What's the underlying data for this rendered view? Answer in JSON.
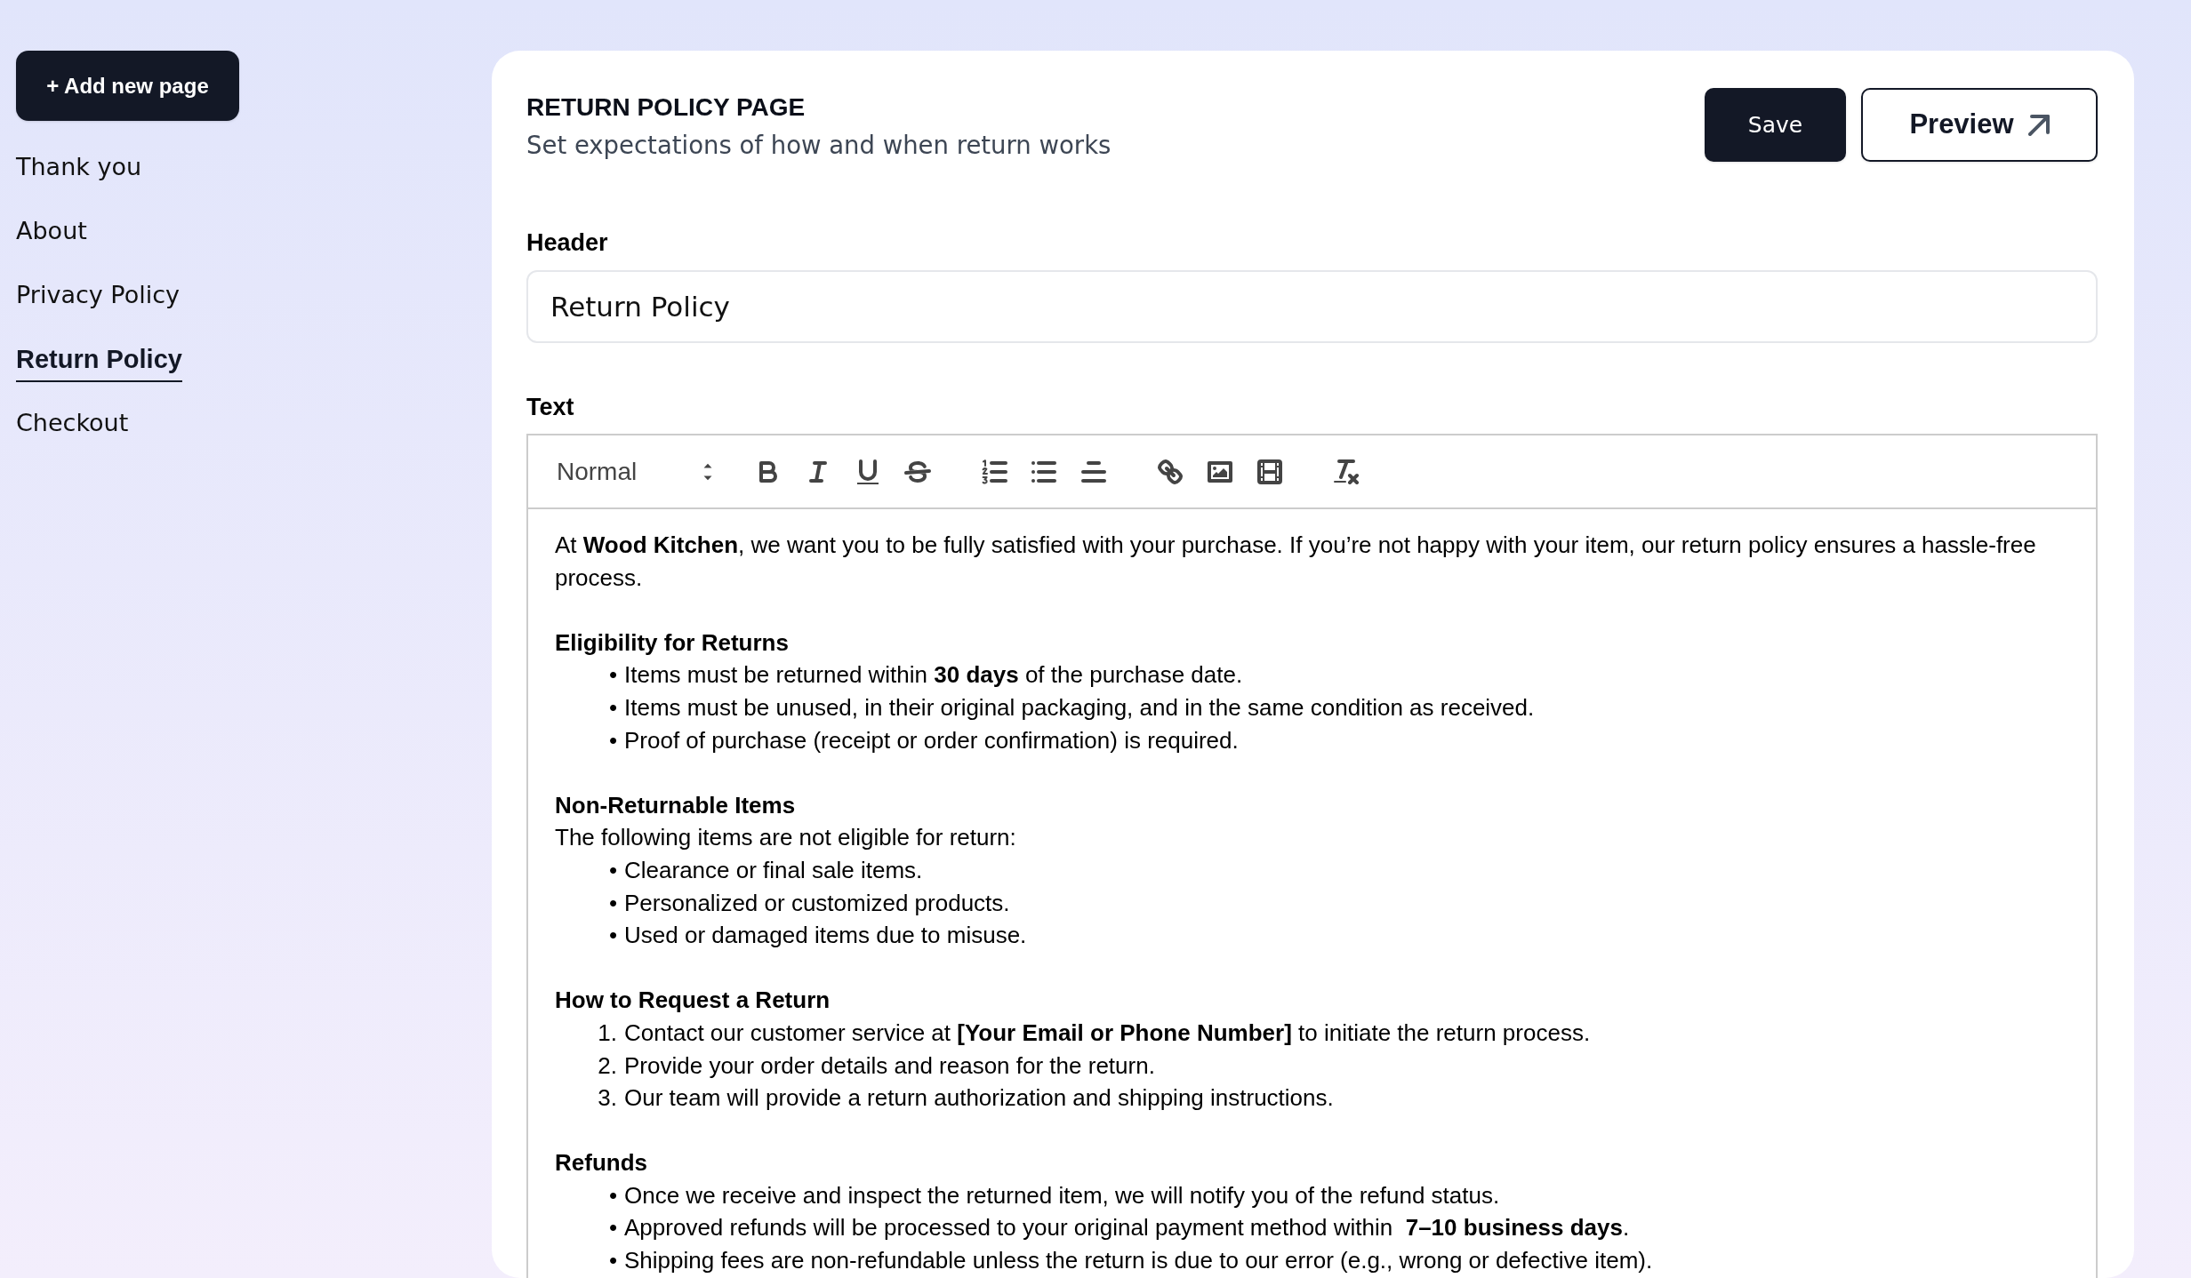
{
  "sidebar": {
    "add_button": {
      "label": "+ Add new page"
    },
    "items": [
      {
        "label": "Thank you",
        "selected": false
      },
      {
        "label": "About",
        "selected": false
      },
      {
        "label": "Privacy Policy",
        "selected": false
      },
      {
        "label": "Return Policy",
        "selected": true
      },
      {
        "label": "Checkout",
        "selected": false
      }
    ]
  },
  "page": {
    "title": "RETURN POLICY PAGE",
    "subtitle": "Set expectations of how and when return works",
    "buttons": [
      {
        "label": "Save",
        "kind": "primary"
      },
      {
        "label": "Preview",
        "kind": "external"
      }
    ]
  },
  "header_field": {
    "label": "Header",
    "value": "Return Policy"
  },
  "text_field": {
    "label": "Text",
    "toolbar": {
      "format": "Normal"
    },
    "content": {
      "intro": "At **Wood Kitchen**, we want you to be fully satisfied with your purchase. If you’re not happy with your item, our return policy ensures a hassle-free process.",
      "sections": [
        {
          "heading": "Eligibility for Returns",
          "items": [
            {
              "marker": "•",
              "text": "Items must be returned within **30 days** of the purchase date."
            },
            {
              "marker": "•",
              "text": "Items must be unused, in their original packaging, and in the same condition as received."
            },
            {
              "marker": "•",
              "text": "Proof of purchase (receipt or order confirmation) is required."
            }
          ]
        },
        {
          "heading": "Non-Returnable Items",
          "lead": "The following items are not eligible for return:",
          "items": [
            {
              "marker": "•",
              "text": "Clearance or final sale items."
            },
            {
              "marker": "•",
              "text": "Personalized or customized products."
            },
            {
              "marker": "•",
              "text": "Used or damaged items due to misuse."
            }
          ]
        },
        {
          "heading": "How to Request a Return",
          "items": [
            {
              "marker": "1.",
              "text": "Contact our customer service at **[Your Email or Phone Number]** to initiate the return process."
            },
            {
              "marker": "2.",
              "text": "Provide your order details and reason for the return."
            },
            {
              "marker": "3.",
              "text": "Our team will provide a return authorization and shipping instructions."
            }
          ]
        },
        {
          "heading": "Refunds",
          "items": [
            {
              "marker": "•",
              "text": "Once we receive and inspect the returned item, we will notify you of the refund status."
            },
            {
              "marker": "•",
              "text": "Approved refunds will be processed to your original payment method within  **7–10 business days**."
            },
            {
              "marker": "•",
              "text": "Shipping fees are non-refundable unless the return is due to our error (e.g., wrong or defective item)."
            }
          ]
        }
      ]
    }
  }
}
